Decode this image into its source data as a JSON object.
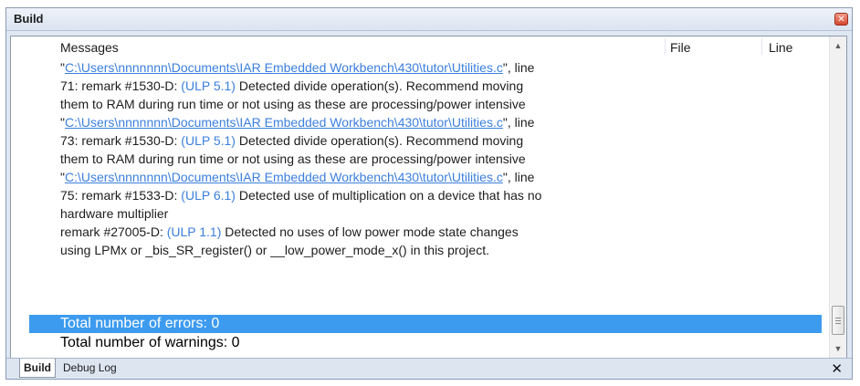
{
  "window": {
    "title": "Build",
    "close_glyph": "✕"
  },
  "columns": {
    "messages": "Messages",
    "file": "File",
    "line": "Line"
  },
  "messages": [
    {
      "parts": [
        {
          "t": "\""
        },
        {
          "t": "C:\\Users\\nnnnnnn\\Documents\\IAR Embedded Workbench\\430\\tutor\\Utilities.c",
          "link": true
        },
        {
          "t": "\", line"
        }
      ]
    },
    {
      "parts": [
        {
          "t": "71: remark #1530-D: "
        },
        {
          "t": "(ULP 5.1)",
          "link2": true
        },
        {
          "t": " Detected divide operation(s). Recommend moving"
        }
      ]
    },
    {
      "parts": [
        {
          "t": "them to RAM during run time or not using as these are processing/power intensive"
        }
      ]
    },
    {
      "parts": [
        {
          "t": "\""
        },
        {
          "t": "C:\\Users\\nnnnnnn\\Documents\\IAR Embedded Workbench\\430\\tutor\\Utilities.c",
          "link": true
        },
        {
          "t": "\", line"
        }
      ]
    },
    {
      "parts": [
        {
          "t": "73: remark #1530-D: "
        },
        {
          "t": "(ULP 5.1)",
          "link2": true
        },
        {
          "t": " Detected divide operation(s). Recommend moving"
        }
      ]
    },
    {
      "parts": [
        {
          "t": "them to RAM during run time or not using as these are processing/power intensive"
        }
      ]
    },
    {
      "parts": [
        {
          "t": "\""
        },
        {
          "t": "C:\\Users\\nnnnnnn\\Documents\\IAR Embedded Workbench\\430\\tutor\\Utilities.c",
          "link": true
        },
        {
          "t": "\", line"
        }
      ]
    },
    {
      "parts": [
        {
          "t": "75: remark #1533-D: "
        },
        {
          "t": "(ULP 6.1)",
          "link2": true
        },
        {
          "t": " Detected use of multiplication on a device that has no"
        }
      ]
    },
    {
      "parts": [
        {
          "t": "hardware multiplier"
        }
      ]
    },
    {
      "parts": [
        {
          "t": "remark #27005-D: "
        },
        {
          "t": "(ULP 1.1)",
          "link2": true
        },
        {
          "t": " Detected no uses of low power mode state changes"
        }
      ]
    },
    {
      "parts": [
        {
          "t": "using LPMx or _bis_SR_register() or __low_power_mode_x() in this project."
        }
      ]
    }
  ],
  "summary": {
    "errors": "Total number of errors: 0",
    "warnings": "Total number of warnings: 0"
  },
  "tabs": {
    "build": "Build",
    "debug_log": "Debug Log",
    "close_glyph": "✕"
  },
  "icons": {
    "close": "close-icon",
    "scroll_up": "chevron-up-icon",
    "scroll_down": "chevron-down-icon"
  },
  "colors": {
    "selection": "#3d9bef",
    "link": "#3b7fdd"
  }
}
